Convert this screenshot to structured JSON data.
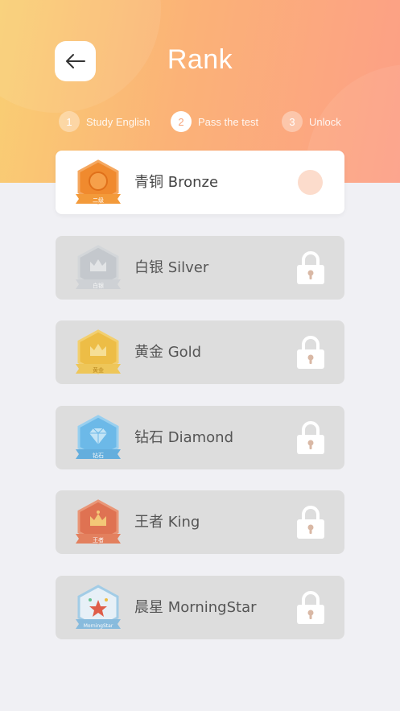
{
  "header": {
    "title": "Rank",
    "back_icon": "arrow-left-icon",
    "gradient": [
      "#f9cf73",
      "#fbb277",
      "#fc9f86"
    ]
  },
  "steps": [
    {
      "num": "1",
      "label": "Study English",
      "active": false
    },
    {
      "num": "2",
      "label": "Pass the test",
      "active": true
    },
    {
      "num": "3",
      "label": "Unlock",
      "active": false
    }
  ],
  "ranks": [
    {
      "name": "青铜 Bronze",
      "badge_text": "二级",
      "color": "#f08a2e",
      "status": "current",
      "icon": "bronze-badge-icon"
    },
    {
      "name": "白银 Silver",
      "badge_text": "白银",
      "color": "#bcc2c8",
      "status": "locked",
      "icon": "silver-badge-icon"
    },
    {
      "name": "黄金 Gold",
      "badge_text": "黄金",
      "color": "#f0b82c",
      "status": "locked",
      "icon": "gold-badge-icon"
    },
    {
      "name": "钻石 Diamond",
      "badge_text": "钻石",
      "color": "#59b3ea",
      "status": "locked",
      "icon": "diamond-badge-icon"
    },
    {
      "name": "王者 King",
      "badge_text": "王者",
      "color": "#e0603a",
      "status": "locked",
      "icon": "king-badge-icon"
    },
    {
      "name": "晨星 MorningStar",
      "badge_text": "MorningStar",
      "color": "#9ccbe8",
      "status": "locked",
      "icon": "morningstar-badge-icon"
    }
  ],
  "colors": {
    "lock": "#ffffff",
    "keyhole": "#d9b8a5",
    "current_dot": "#fcdccc"
  }
}
